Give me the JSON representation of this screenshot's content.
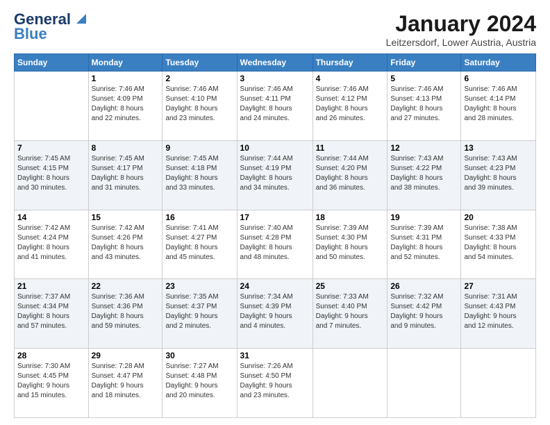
{
  "header": {
    "logo_line1": "General",
    "logo_line2": "Blue",
    "main_title": "January 2024",
    "subtitle": "Leitzersdorf, Lower Austria, Austria"
  },
  "calendar": {
    "days_of_week": [
      "Sunday",
      "Monday",
      "Tuesday",
      "Wednesday",
      "Thursday",
      "Friday",
      "Saturday"
    ],
    "weeks": [
      [
        {
          "day": "",
          "info": ""
        },
        {
          "day": "1",
          "info": "Sunrise: 7:46 AM\nSunset: 4:09 PM\nDaylight: 8 hours\nand 22 minutes."
        },
        {
          "day": "2",
          "info": "Sunrise: 7:46 AM\nSunset: 4:10 PM\nDaylight: 8 hours\nand 23 minutes."
        },
        {
          "day": "3",
          "info": "Sunrise: 7:46 AM\nSunset: 4:11 PM\nDaylight: 8 hours\nand 24 minutes."
        },
        {
          "day": "4",
          "info": "Sunrise: 7:46 AM\nSunset: 4:12 PM\nDaylight: 8 hours\nand 26 minutes."
        },
        {
          "day": "5",
          "info": "Sunrise: 7:46 AM\nSunset: 4:13 PM\nDaylight: 8 hours\nand 27 minutes."
        },
        {
          "day": "6",
          "info": "Sunrise: 7:46 AM\nSunset: 4:14 PM\nDaylight: 8 hours\nand 28 minutes."
        }
      ],
      [
        {
          "day": "7",
          "info": "Sunrise: 7:45 AM\nSunset: 4:15 PM\nDaylight: 8 hours\nand 30 minutes."
        },
        {
          "day": "8",
          "info": "Sunrise: 7:45 AM\nSunset: 4:17 PM\nDaylight: 8 hours\nand 31 minutes."
        },
        {
          "day": "9",
          "info": "Sunrise: 7:45 AM\nSunset: 4:18 PM\nDaylight: 8 hours\nand 33 minutes."
        },
        {
          "day": "10",
          "info": "Sunrise: 7:44 AM\nSunset: 4:19 PM\nDaylight: 8 hours\nand 34 minutes."
        },
        {
          "day": "11",
          "info": "Sunrise: 7:44 AM\nSunset: 4:20 PM\nDaylight: 8 hours\nand 36 minutes."
        },
        {
          "day": "12",
          "info": "Sunrise: 7:43 AM\nSunset: 4:22 PM\nDaylight: 8 hours\nand 38 minutes."
        },
        {
          "day": "13",
          "info": "Sunrise: 7:43 AM\nSunset: 4:23 PM\nDaylight: 8 hours\nand 39 minutes."
        }
      ],
      [
        {
          "day": "14",
          "info": "Sunrise: 7:42 AM\nSunset: 4:24 PM\nDaylight: 8 hours\nand 41 minutes."
        },
        {
          "day": "15",
          "info": "Sunrise: 7:42 AM\nSunset: 4:26 PM\nDaylight: 8 hours\nand 43 minutes."
        },
        {
          "day": "16",
          "info": "Sunrise: 7:41 AM\nSunset: 4:27 PM\nDaylight: 8 hours\nand 45 minutes."
        },
        {
          "day": "17",
          "info": "Sunrise: 7:40 AM\nSunset: 4:28 PM\nDaylight: 8 hours\nand 48 minutes."
        },
        {
          "day": "18",
          "info": "Sunrise: 7:39 AM\nSunset: 4:30 PM\nDaylight: 8 hours\nand 50 minutes."
        },
        {
          "day": "19",
          "info": "Sunrise: 7:39 AM\nSunset: 4:31 PM\nDaylight: 8 hours\nand 52 minutes."
        },
        {
          "day": "20",
          "info": "Sunrise: 7:38 AM\nSunset: 4:33 PM\nDaylight: 8 hours\nand 54 minutes."
        }
      ],
      [
        {
          "day": "21",
          "info": "Sunrise: 7:37 AM\nSunset: 4:34 PM\nDaylight: 8 hours\nand 57 minutes."
        },
        {
          "day": "22",
          "info": "Sunrise: 7:36 AM\nSunset: 4:36 PM\nDaylight: 8 hours\nand 59 minutes."
        },
        {
          "day": "23",
          "info": "Sunrise: 7:35 AM\nSunset: 4:37 PM\nDaylight: 9 hours\nand 2 minutes."
        },
        {
          "day": "24",
          "info": "Sunrise: 7:34 AM\nSunset: 4:39 PM\nDaylight: 9 hours\nand 4 minutes."
        },
        {
          "day": "25",
          "info": "Sunrise: 7:33 AM\nSunset: 4:40 PM\nDaylight: 9 hours\nand 7 minutes."
        },
        {
          "day": "26",
          "info": "Sunrise: 7:32 AM\nSunset: 4:42 PM\nDaylight: 9 hours\nand 9 minutes."
        },
        {
          "day": "27",
          "info": "Sunrise: 7:31 AM\nSunset: 4:43 PM\nDaylight: 9 hours\nand 12 minutes."
        }
      ],
      [
        {
          "day": "28",
          "info": "Sunrise: 7:30 AM\nSunset: 4:45 PM\nDaylight: 9 hours\nand 15 minutes."
        },
        {
          "day": "29",
          "info": "Sunrise: 7:28 AM\nSunset: 4:47 PM\nDaylight: 9 hours\nand 18 minutes."
        },
        {
          "day": "30",
          "info": "Sunrise: 7:27 AM\nSunset: 4:48 PM\nDaylight: 9 hours\nand 20 minutes."
        },
        {
          "day": "31",
          "info": "Sunrise: 7:26 AM\nSunset: 4:50 PM\nDaylight: 9 hours\nand 23 minutes."
        },
        {
          "day": "",
          "info": ""
        },
        {
          "day": "",
          "info": ""
        },
        {
          "day": "",
          "info": ""
        }
      ]
    ]
  }
}
